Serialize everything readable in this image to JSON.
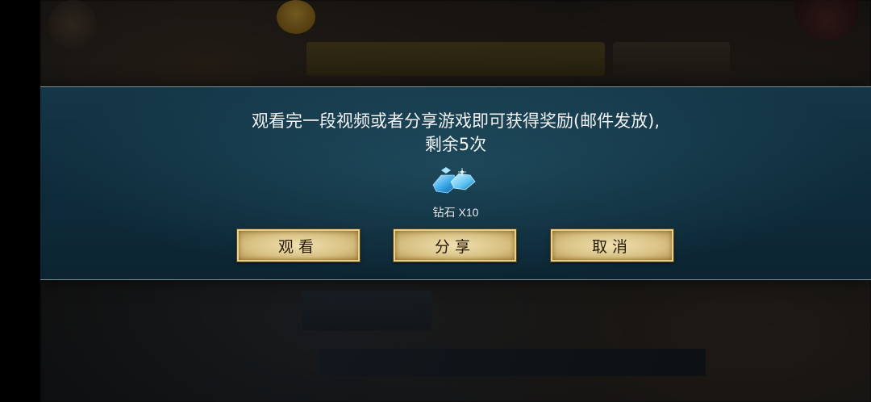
{
  "dialog": {
    "message_line1": "观看完一段视频或者分享游戏即可获得奖励(邮件发放),",
    "message_line2": "剩余5次",
    "reward": {
      "icon": "diamond-icon",
      "label": "钻石 X10"
    },
    "buttons": {
      "watch_label": "观看",
      "share_label": "分享",
      "cancel_label": "取消"
    }
  },
  "colors": {
    "dialog_bg": "#0f2c3b",
    "button_face": "#d8c183",
    "button_border": "#e9d18a",
    "button_text": "#2a1a08",
    "diamond": "#3aa8e8"
  }
}
